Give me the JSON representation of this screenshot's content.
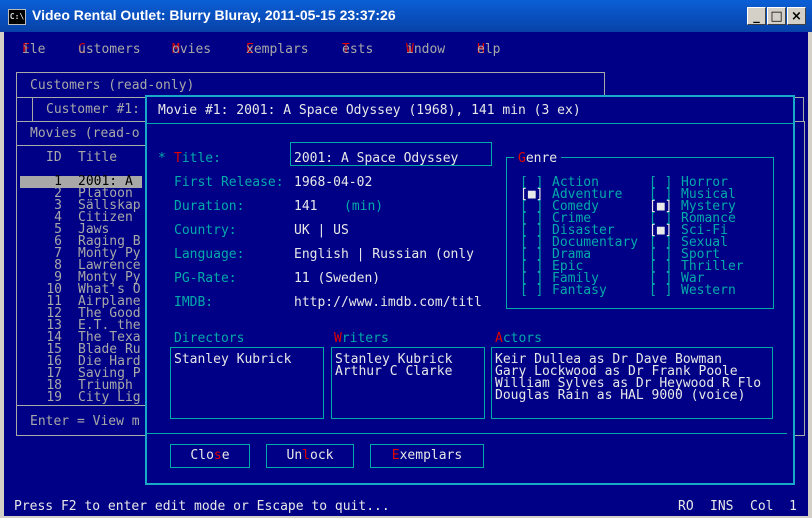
{
  "window": {
    "title": "Video Rental Outlet: Blurry Bluray, 2011-05-15 23:37:26",
    "icon_text": "C:\\"
  },
  "menu": [
    {
      "hot": "F",
      "rest": "ile"
    },
    {
      "hot": "C",
      "rest": "ustomers"
    },
    {
      "hot": "M",
      "rest": "ovies"
    },
    {
      "hot": "E",
      "rest": "xemplars"
    },
    {
      "hot": "T",
      "rest": "ests"
    },
    {
      "hot": "W",
      "rest": "indow"
    },
    {
      "hot": "H",
      "rest": "elp"
    }
  ],
  "bg": {
    "customers_title": "Customers (read-only)",
    "customer1_title": "Customer #1:",
    "movies_title": "Movies (read-o",
    "col_id": "ID",
    "col_title": "Title",
    "rows": [
      {
        "id": "1",
        "title": "2001: A"
      },
      {
        "id": "2",
        "title": "Platoon"
      },
      {
        "id": "3",
        "title": "Sällskap"
      },
      {
        "id": "4",
        "title": "Citizen"
      },
      {
        "id": "5",
        "title": "Jaws"
      },
      {
        "id": "6",
        "title": "Raging B"
      },
      {
        "id": "7",
        "title": "Monty Py"
      },
      {
        "id": "8",
        "title": "Lawrence"
      },
      {
        "id": "9",
        "title": "Monty Py"
      },
      {
        "id": "10",
        "title": "What's O"
      },
      {
        "id": "11",
        "title": "Airplane"
      },
      {
        "id": "12",
        "title": "The Good"
      },
      {
        "id": "13",
        "title": "E.T. the"
      },
      {
        "id": "14",
        "title": "The Texa"
      },
      {
        "id": "15",
        "title": "Blade Ru"
      },
      {
        "id": "16",
        "title": "Die Hard"
      },
      {
        "id": "17",
        "title": "Saving P"
      },
      {
        "id": "18",
        "title": "Triumph"
      },
      {
        "id": "19",
        "title": "City Lig"
      }
    ],
    "footer": "Enter = View m"
  },
  "modal": {
    "title": "Movie #1: 2001: A Space Odyssey (1968), 141 min (3 ex)",
    "marker": "*",
    "title_label_hot": "T",
    "title_label_rest": "itle:",
    "title_value": "2001: A Space Odyssey",
    "fields": [
      {
        "label": "First Release:",
        "value": "1968-04-02",
        "unit": ""
      },
      {
        "label": "Duration:",
        "value": "141",
        "unit": "(min)"
      },
      {
        "label": "Country:",
        "value": "UK | US",
        "unit": ""
      },
      {
        "label": "Language:",
        "value": "English | Russian (only",
        "unit": ""
      },
      {
        "label": "PG-Rate:",
        "value": "11 (Sweden)",
        "unit": ""
      },
      {
        "label": "IMDB:",
        "value": "http://www.imdb.com/titl",
        "unit": ""
      }
    ],
    "genre_hot": "G",
    "genre_rest": "enre",
    "genres_left": [
      {
        "name": "Action",
        "checked": false
      },
      {
        "name": "Adventure",
        "checked": true
      },
      {
        "name": "Comedy",
        "checked": false
      },
      {
        "name": "Crime",
        "checked": false
      },
      {
        "name": "Disaster",
        "checked": false
      },
      {
        "name": "Documentary",
        "checked": false
      },
      {
        "name": "Drama",
        "checked": false
      },
      {
        "name": "Epic",
        "checked": false
      },
      {
        "name": "Family",
        "checked": false
      },
      {
        "name": "Fantasy",
        "checked": false
      }
    ],
    "genres_right": [
      {
        "name": "Horror",
        "checked": false
      },
      {
        "name": "Musical",
        "checked": false
      },
      {
        "name": "Mystery",
        "checked": true
      },
      {
        "name": "Romance",
        "checked": false
      },
      {
        "name": "Sci-Fi",
        "checked": true
      },
      {
        "name": "Sexual",
        "checked": false
      },
      {
        "name": "Sport",
        "checked": false
      },
      {
        "name": "Thriller",
        "checked": false
      },
      {
        "name": "War",
        "checked": false
      },
      {
        "name": "Western",
        "checked": false
      }
    ],
    "directors_label": "Directors",
    "writers_hot": "W",
    "writers_rest": "riters",
    "actors_hot": "A",
    "actors_rest": "ctors",
    "directors": [
      "Stanley Kubrick"
    ],
    "writers": [
      "Stanley Kubrick",
      "Arthur C Clarke"
    ],
    "actors": [
      "Keir Dullea as Dr Dave Bowman",
      "Gary Lockwood as Dr Frank Poole",
      "William Sylves as Dr Heywood R Flo",
      "Douglas Rain as HAL 9000 (voice)"
    ],
    "buttons": [
      {
        "pre": "Clo",
        "hot": "s",
        "post": "e"
      },
      {
        "pre": "Un",
        "hot": "l",
        "post": "ock"
      },
      {
        "pre": "",
        "hot": "E",
        "post": "xemplars"
      }
    ]
  },
  "status": {
    "message": "Press F2 to enter edit mode or Escape to quit...",
    "ro": "RO",
    "ins": "INS",
    "col": "Col  1"
  },
  "colors": {
    "screen_bg": "#000086",
    "accent_cyan": "#00aaaa",
    "hotkey_red": "#e00000",
    "text_white": "#e8e8e8",
    "text_gray": "#a8a8a8"
  }
}
